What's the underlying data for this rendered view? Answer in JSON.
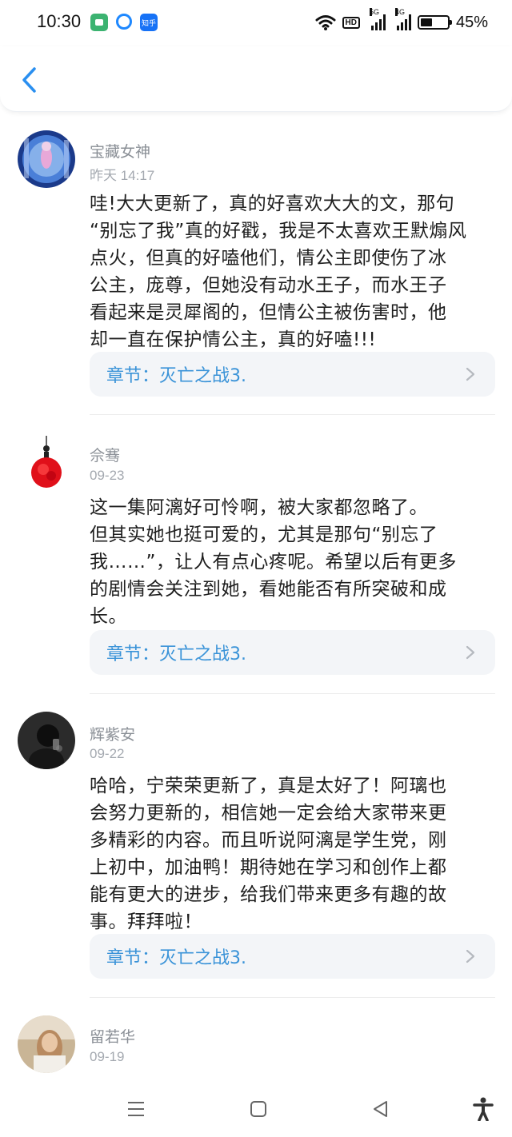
{
  "status_bar": {
    "time": "10:30",
    "apps": [
      {
        "icon": "wechat-work-icon",
        "label": ""
      },
      {
        "icon": "ring-app-icon",
        "label": ""
      },
      {
        "icon": "zhihu-icon",
        "label": "知乎"
      }
    ],
    "hd_label": "HD",
    "signal_1_label": "5G",
    "signal_2_label": "4G",
    "battery_percent": "45%",
    "battery_level": 0.45
  },
  "header": {
    "back_icon": "chevron-left-icon",
    "accent_color": "#2a8ff0"
  },
  "comments": [
    {
      "username": "宝藏女神",
      "date": "昨天 14:17",
      "lines": [
        "哇!大大更新了，真的好喜欢大大的文，那句",
        "“别忘了我”真的好戳，我是不太喜欢王默煽风",
        "点火，但真的好嗑他们，情公主即使伤了冰",
        "公主，庞尊，但她没有动水王子，而水王子",
        "看起来是灵犀阁的，但情公主被伤害时，他",
        "却一直在保护情公主，真的好嗑!!!"
      ],
      "chapter": "章节：灭亡之战3."
    },
    {
      "username": "佘骞",
      "date": "09-23",
      "lines": [
        "这一集阿漓好可怜啊，被大家都忽略了。",
        "但其实她也挺可爱的，尤其是那句“别忘了",
        "我……”，让人有点心疼呢。希望以后有更多",
        "的剧情会关注到她，看她能否有所突破和成",
        "长。"
      ],
      "chapter": "章节：灭亡之战3."
    },
    {
      "username": "辉紫安",
      "date": "09-22",
      "lines": [
        "哈哈，宁荣荣更新了，真是太好了！阿璃也",
        "会努力更新的，相信她一定会给大家带来更",
        "多精彩的内容。而且听说阿漓是学生党，刚",
        "上初中，加油鸭！期待她在学习和创作上都",
        "能有更大的进步，给我们带来更多有趣的故",
        "事。拜拜啦！"
      ],
      "chapter": "章节：灭亡之战3."
    },
    {
      "username": "留若华",
      "date": "09-19"
    }
  ],
  "nav_bar": {
    "items": [
      "menu-icon",
      "home-square-icon",
      "back-triangle-icon",
      "accessibility-icon"
    ]
  }
}
